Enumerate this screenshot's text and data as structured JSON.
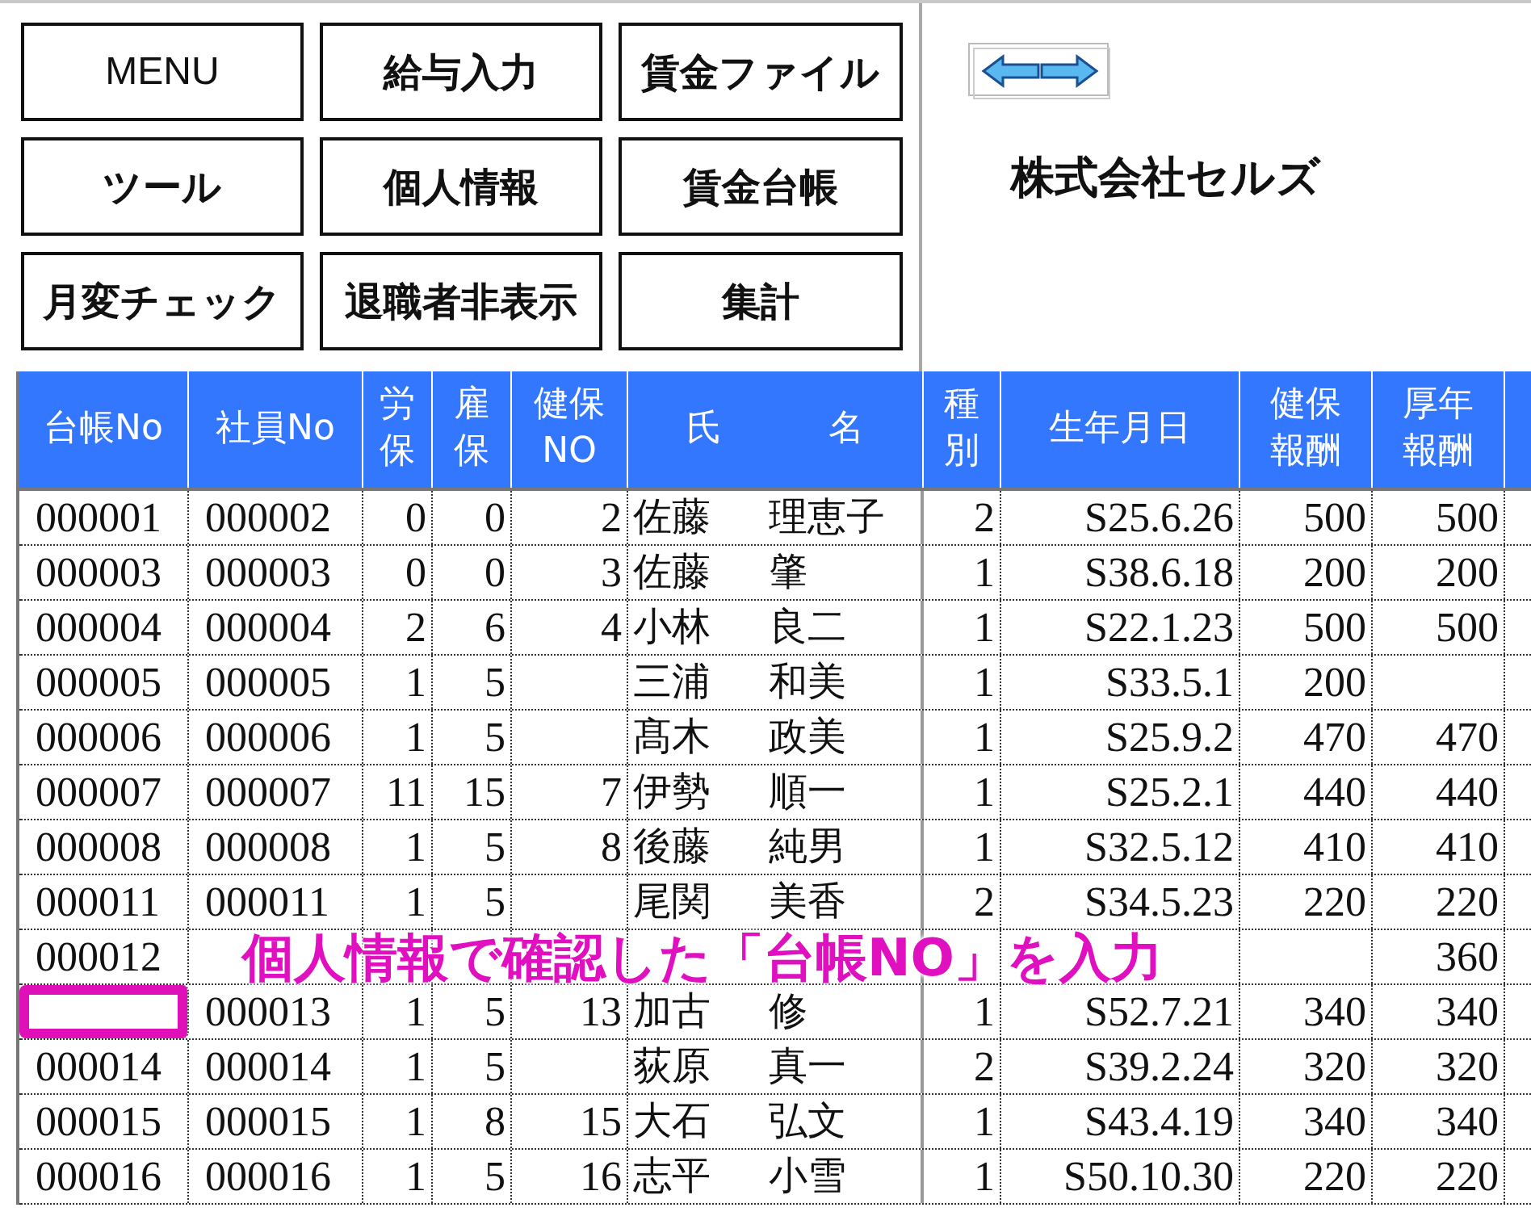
{
  "buttons": [
    {
      "label": "MENU",
      "kind": "latin"
    },
    {
      "label": "給与入力",
      "kind": "jp"
    },
    {
      "label": "賃金ファイル",
      "kind": "jp"
    },
    {
      "label": "ツール",
      "kind": "jp"
    },
    {
      "label": "個人情報",
      "kind": "jp"
    },
    {
      "label": "賃金台帳",
      "kind": "jp"
    },
    {
      "label": "月変チェック",
      "kind": "jp"
    },
    {
      "label": "退職者非表示",
      "kind": "jp"
    },
    {
      "label": "集計",
      "kind": "jp"
    }
  ],
  "company": "株式会社セルズ",
  "columns": [
    {
      "lines": [
        "台帳No"
      ],
      "kind": "code"
    },
    {
      "lines": [
        "社員No"
      ],
      "kind": "code"
    },
    {
      "lines": [
        "労",
        "保"
      ],
      "kind": "number"
    },
    {
      "lines": [
        "雇",
        "保"
      ],
      "kind": "number"
    },
    {
      "lines": [
        "健保",
        "NO"
      ],
      "kind": "number"
    },
    {
      "lines": [
        "氏　　　名"
      ],
      "kind": "name"
    },
    {
      "lines": [
        "種",
        "別"
      ],
      "kind": "number"
    },
    {
      "lines": [
        "生年月日"
      ],
      "kind": "number"
    },
    {
      "lines": [
        "健保",
        "報酬"
      ],
      "kind": "number"
    },
    {
      "lines": [
        "厚年",
        "報酬"
      ],
      "kind": "number"
    }
  ],
  "rows": [
    {
      "cells": [
        "000001",
        "000002",
        "0",
        "0",
        "2",
        [
          "佐藤",
          "理恵子"
        ],
        "2",
        "S25.6.26",
        "500",
        "500"
      ],
      "marked": false
    },
    {
      "cells": [
        "000003",
        "000003",
        "0",
        "0",
        "3",
        [
          "佐藤",
          "肇"
        ],
        "1",
        "S38.6.18",
        "200",
        "200"
      ],
      "marked": false
    },
    {
      "cells": [
        "000004",
        "000004",
        "2",
        "6",
        "4",
        [
          "小林",
          "良二"
        ],
        "1",
        "S22.1.23",
        "500",
        "500"
      ],
      "marked": false
    },
    {
      "cells": [
        "000005",
        "000005",
        "1",
        "5",
        null,
        [
          "三浦",
          "和美"
        ],
        "1",
        "S33.5.1",
        "200",
        null
      ],
      "marked": false
    },
    {
      "cells": [
        "000006",
        "000006",
        "1",
        "5",
        null,
        [
          "髙木",
          "政美"
        ],
        "1",
        "S25.9.2",
        "470",
        "470"
      ],
      "marked": false
    },
    {
      "cells": [
        "000007",
        "000007",
        "11",
        "15",
        "7",
        [
          "伊勢",
          "順一"
        ],
        "1",
        "S25.2.1",
        "440",
        "440"
      ],
      "marked": false
    },
    {
      "cells": [
        "000008",
        "000008",
        "1",
        "5",
        "8",
        [
          "後藤",
          "純男"
        ],
        "1",
        "S32.5.12",
        "410",
        "410"
      ],
      "marked": false
    },
    {
      "cells": [
        "000011",
        "000011",
        "1",
        "5",
        null,
        [
          "尾関",
          "美香"
        ],
        "2",
        "S34.5.23",
        "220",
        "220"
      ],
      "marked": false
    },
    {
      "cells": [
        "000012",
        null,
        null,
        null,
        null,
        null,
        null,
        null,
        null,
        "360"
      ],
      "marked": false
    },
    {
      "cells": [
        null,
        "000013",
        "1",
        "5",
        "13",
        [
          "加古",
          "修"
        ],
        "1",
        "S52.7.21",
        "340",
        "340"
      ],
      "marked": true
    },
    {
      "cells": [
        "000014",
        "000014",
        "1",
        "5",
        null,
        [
          "荻原",
          "真一"
        ],
        "2",
        "S39.2.24",
        "320",
        "320"
      ],
      "marked": false
    },
    {
      "cells": [
        "000015",
        "000015",
        "1",
        "8",
        "15",
        [
          "大石",
          "弘文"
        ],
        "1",
        "S43.4.19",
        "340",
        "340"
      ],
      "marked": false
    },
    {
      "cells": [
        "000016",
        "000016",
        "1",
        "5",
        "16",
        [
          "志平",
          "小雪"
        ],
        "1",
        "S50.10.30",
        "220",
        "220"
      ],
      "marked": false
    }
  ],
  "callout": "個人情報で確認した「台帳NO」を入力"
}
